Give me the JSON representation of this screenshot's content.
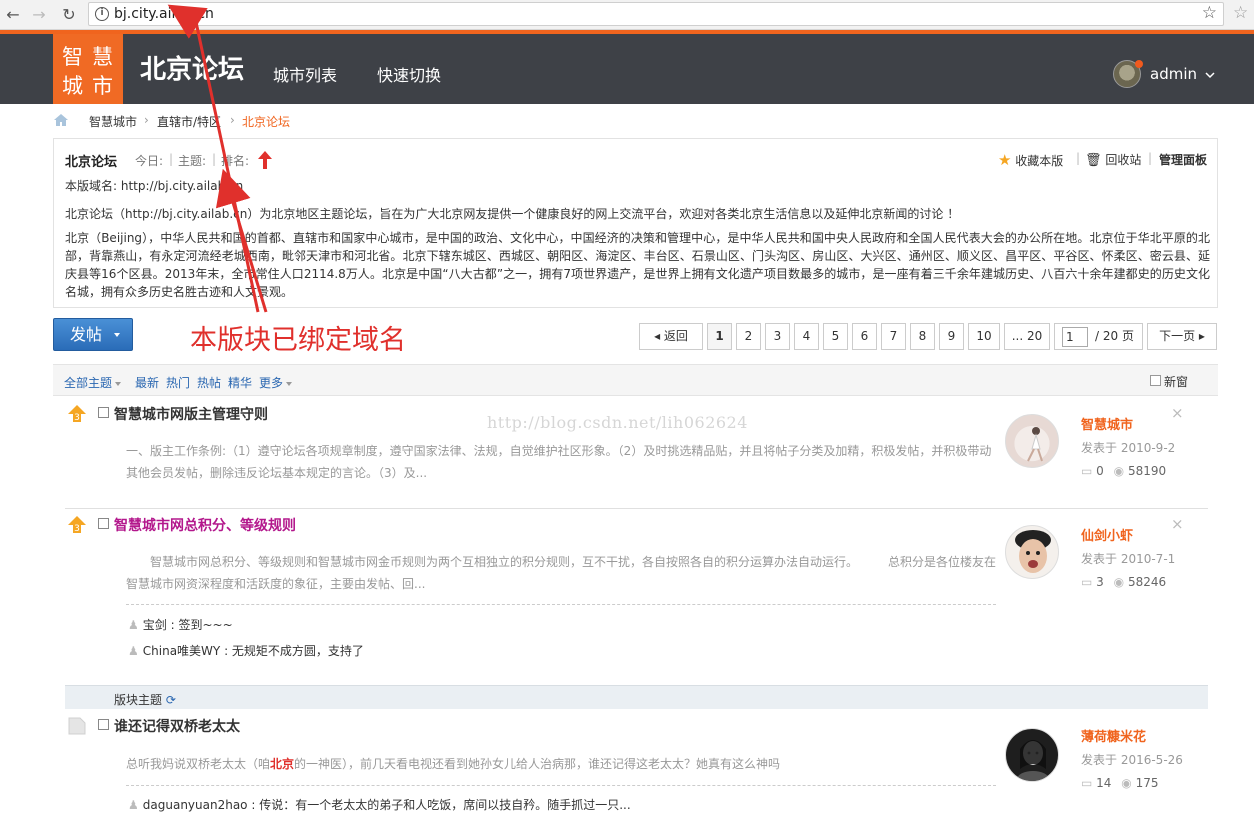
{
  "browser": {
    "url": "bj.city.ailab.cn",
    "back_icon": "arrow-left-icon",
    "forward_icon": "arrow-right-icon",
    "reload_icon": "reload-icon"
  },
  "header": {
    "logo_chars": [
      "智",
      "慧",
      "城",
      "市"
    ],
    "site_title": "北京论坛",
    "nav": [
      "城市列表",
      "快速切换"
    ],
    "user_name": "admin"
  },
  "breadcrumb": [
    "智慧城市",
    "直辖市/特区",
    "北京论坛"
  ],
  "forum": {
    "title": "北京论坛",
    "today_label": "今日:",
    "topics_label": "主题:",
    "rank_label": "排名:",
    "actions": [
      "收藏本版",
      "回收站",
      "管理面板"
    ],
    "domain_line": "本版域名: http://bj.city.ailab.cn",
    "desc1": "北京论坛（http://bj.city.ailab.cn）为北京地区主题论坛，旨在为广大北京网友提供一个健康良好的网上交流平台，欢迎对各类北京生活信息以及延伸北京新闻的讨论 ！",
    "desc2": "北京（Beijing），中华人民共和国的首都、直辖市和国家中心城市，是中国的政治、文化中心，中国经济的决策和管理中心，是中华人民共和国中央人民政府和全国人民代表大会的办公所在地。北京位于华北平原的北部，背靠燕山，有永定河流经老城西南，毗邻天津市和河北省。北京下辖东城区、西城区、朝阳区、海淀区、丰台区、石景山区、门头沟区、房山区、大兴区、通州区、顺义区、昌平区、平谷区、怀柔区、密云县、延庆县等16个区县。2013年末，全市常住人口2114.8万人。北京是中国“八大古都”之一，拥有7项世界遗产，是世界上拥有文化遗产项目数最多的城市，是一座有着三千余年建城历史、八百六十余年建都史的历史文化名城，拥有众多历史名胜古迹和人文景观。"
  },
  "annotation": "本版块已绑定域名",
  "post_button": "发帖",
  "pager": {
    "prev": "返回",
    "pages": [
      "1",
      "2",
      "3",
      "4",
      "5",
      "6",
      "7",
      "8",
      "9",
      "10",
      "... 20"
    ],
    "current": "1",
    "total": "/ 20 页",
    "next": "下一页"
  },
  "filters": {
    "all": "全部主题",
    "items": [
      "最新",
      "热门",
      "热帖",
      "精华"
    ],
    "more": "更多",
    "new_window": "新窗"
  },
  "watermark": "http://blog.csdn.net/lih062624",
  "threads": [
    {
      "title": "智慧城市网版主管理守则",
      "title_color": "#222222",
      "excerpt": "一、版主工作条例:（1）遵守论坛各项规章制度，遵守国家法律、法规，自觉维护社区形象。（2）及时挑选精品贴，并且将帖子分类及加精，积极发帖，并积极带动其他会员发帖，删除违反论坛基本规定的言论。（3）及...",
      "author": "智慧城市",
      "date": "发表于 2010-9-2",
      "replies": "0",
      "views": "58190"
    },
    {
      "title": "智慧城市网总积分、等级规则",
      "title_color": "#b3178c",
      "excerpt": "智慧城市网总积分、等级规则和智慧城市网金币规则为两个互相独立的积分规则，互不干扰，各自按照各自的积分运算办法自动运行。　　　总积分是各位楼友在智慧城市网资深程度和活跃度的象征，主要由发帖、回...",
      "author": "仙剑小虾",
      "date": "发表于 2010-7-1",
      "replies": "3",
      "views": "58246",
      "reply_lines": [
        {
          "user": "宝剑",
          "text": "签到~~~"
        },
        {
          "user": "China唯美WY",
          "text": "无规矩不成方圆，支持了"
        }
      ]
    },
    {
      "title": "谁还记得双桥老太太",
      "title_color": "#222222",
      "excerpt_pre": "总听我妈说双桥老太太（咱",
      "excerpt_highlight": "北京",
      "excerpt_post": "的一神医），前几天看电视还看到她孙女儿给人治病那，谁还记得这老太太？她真有这么神吗",
      "author": "薄荷糠米花",
      "date": "发表于 2016-5-26",
      "replies": "14",
      "views": "175",
      "reply_lines": [
        {
          "user": "daguanyuan2hao",
          "text": "传说：有一个老太太的弟子和人吃饭，席间以技自矜。随手抓过一只..."
        }
      ]
    }
  ],
  "section_label": "版块主题",
  "colors": {
    "accent": "#f0641e",
    "header_bg": "#3e4147",
    "link": "#2a67b1",
    "annotation": "#e0302c"
  }
}
